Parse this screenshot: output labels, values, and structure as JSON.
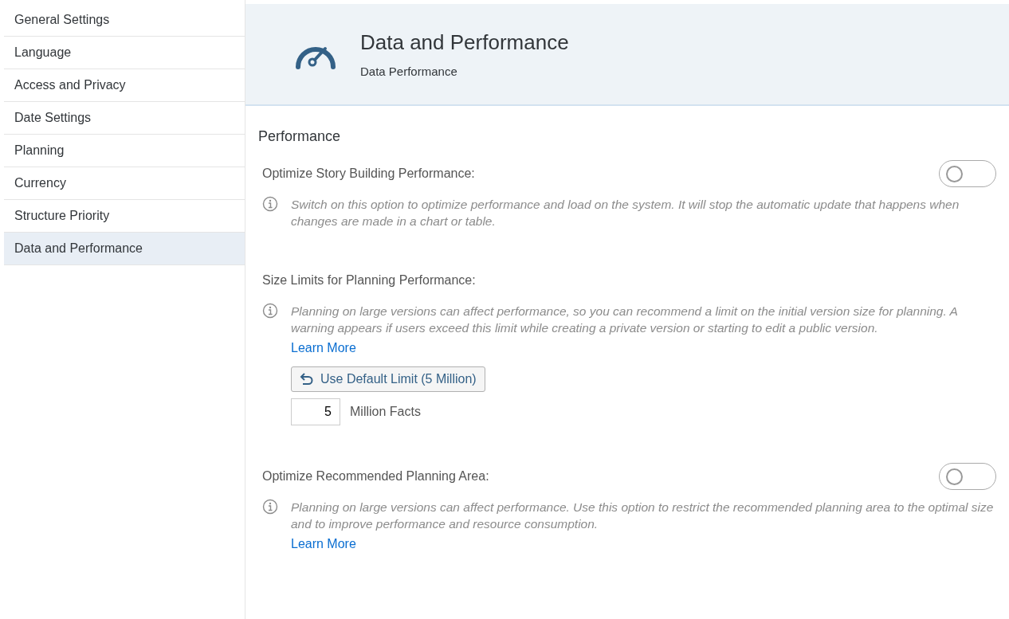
{
  "sidebar": {
    "items": [
      {
        "label": "General Settings",
        "selected": false
      },
      {
        "label": "Language",
        "selected": false
      },
      {
        "label": "Access and Privacy",
        "selected": false
      },
      {
        "label": "Date Settings",
        "selected": false
      },
      {
        "label": "Planning",
        "selected": false
      },
      {
        "label": "Currency",
        "selected": false
      },
      {
        "label": "Structure Priority",
        "selected": false
      },
      {
        "label": "Data and Performance",
        "selected": true
      }
    ]
  },
  "header": {
    "title": "Data and Performance",
    "subtitle": "Data Performance"
  },
  "section": {
    "title": "Performance"
  },
  "settings": [
    {
      "kind": "toggle",
      "label": "Optimize Story Building Performance:",
      "on": false,
      "description": "Switch on this option to optimize performance and load on the system. It will stop the automatic update that happens when changes are made in a chart or table."
    },
    {
      "kind": "limit",
      "label": "Size Limits for Planning Performance:",
      "description": "Planning on large versions can affect performance, so you can recommend a limit on the initial version size for planning. A warning appears if users exceed this limit while creating a private version or starting to edit a public version.",
      "link": "Learn More",
      "button": "Use Default Limit (5 Million)",
      "value": "5",
      "unit": "Million Facts"
    },
    {
      "kind": "toggle",
      "label": "Optimize Recommended Planning Area:",
      "on": false,
      "description": "Planning on large versions can affect performance. Use this option to restrict the recommended planning area to the optimal size and to improve performance and resource consumption.",
      "link": "Learn More"
    }
  ]
}
